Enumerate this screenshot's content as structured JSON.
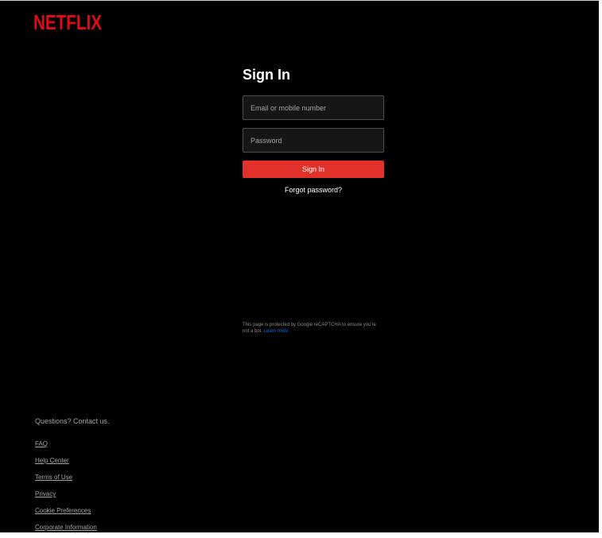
{
  "brand": {
    "name": "NETFLIX",
    "color": "#e50914"
  },
  "signin": {
    "title": "Sign In",
    "email_placeholder": "Email or mobile number",
    "password_placeholder": "Password",
    "submit_label": "Sign In",
    "forgot_label": "Forgot password?",
    "button_color": "#e2302b"
  },
  "recaptcha": {
    "text": "This page is protected by Google reCAPTCHA to ensure you're not a bot.",
    "link_label": "Learn more."
  },
  "footer": {
    "contact": "Questions? Contact us.",
    "links": [
      "FAQ",
      "Help Center",
      "Terms of Use",
      "Privacy",
      "Cookie Preferences",
      "Corporate Information"
    ]
  }
}
